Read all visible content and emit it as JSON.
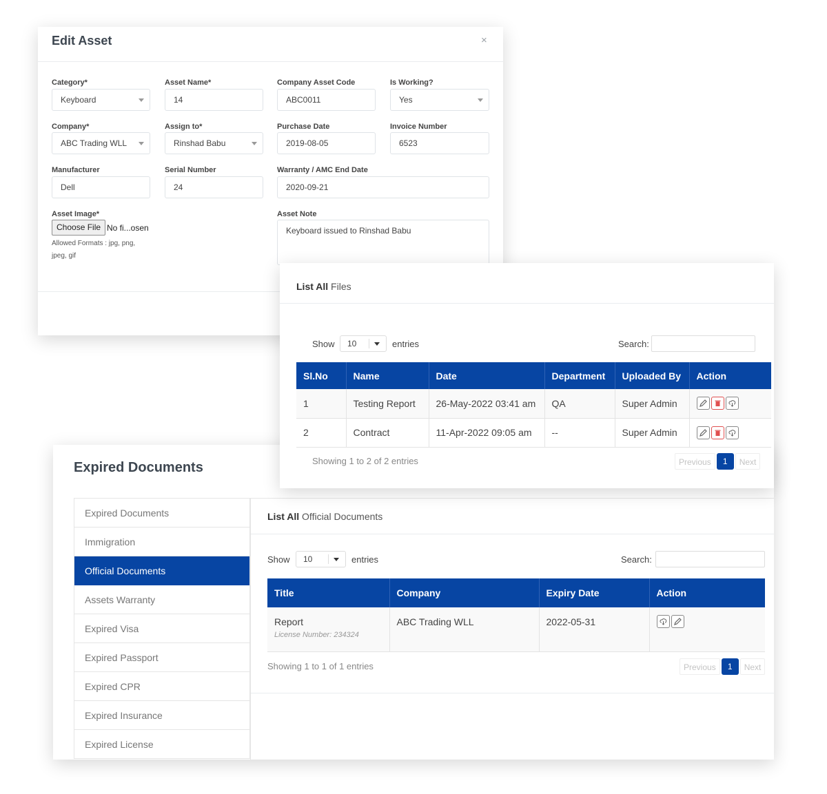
{
  "edit_asset": {
    "title": "Edit Asset",
    "close": "×",
    "fields": {
      "category": {
        "label": "Category*",
        "value": "Keyboard"
      },
      "asset_name": {
        "label": "Asset Name*",
        "value": "14"
      },
      "company_asset_code": {
        "label": "Company Asset Code",
        "value": "ABC0011"
      },
      "is_working": {
        "label": "Is Working?",
        "value": "Yes"
      },
      "company": {
        "label": "Company*",
        "value": "ABC Trading WLL"
      },
      "assign_to": {
        "label": "Assign to*",
        "value": "Rinshad Babu"
      },
      "purchase_date": {
        "label": "Purchase Date",
        "value": "2019-08-05"
      },
      "invoice_number": {
        "label": "Invoice Number",
        "value": "6523"
      },
      "manufacturer": {
        "label": "Manufacturer",
        "value": "Dell"
      },
      "serial_number": {
        "label": "Serial Number",
        "value": "24"
      },
      "warranty_end": {
        "label": "Warranty / AMC End Date",
        "value": "2020-09-21"
      },
      "asset_image": {
        "label": "Asset Image*",
        "button": "Choose File",
        "status": "No fi...osen",
        "hint": "Allowed Formats : jpg, png, jpeg, gif"
      },
      "asset_note": {
        "label": "Asset Note",
        "value": "Keyboard issued to Rinshad Babu"
      }
    }
  },
  "files_panel": {
    "title_bold": "List All",
    "title_rest": "Files",
    "show_label": "Show",
    "entries_value": "10",
    "entries_label": "entries",
    "search_label": "Search:",
    "columns": [
      "Sl.No",
      "Name",
      "Date",
      "Department",
      "Uploaded By",
      "Action"
    ],
    "rows": [
      {
        "sl": "1",
        "name": "Testing Report",
        "date": "26-May-2022 03:41 am",
        "department": "QA",
        "uploaded_by": "Super Admin"
      },
      {
        "sl": "2",
        "name": "Contract",
        "date": "11-Apr-2022 09:05 am",
        "department": "--",
        "uploaded_by": "Super Admin"
      }
    ],
    "info": "Showing 1 to 2 of 2 entries",
    "pagination": {
      "previous": "Previous",
      "current": "1",
      "next": "Next"
    }
  },
  "expired_panel": {
    "title": "Expired Documents",
    "sidebar": [
      {
        "label": "Expired Documents",
        "active": false
      },
      {
        "label": "Immigration",
        "active": false
      },
      {
        "label": "Official Documents",
        "active": true
      },
      {
        "label": "Assets Warranty",
        "active": false
      },
      {
        "label": "Expired Visa",
        "active": false
      },
      {
        "label": "Expired Passport",
        "active": false
      },
      {
        "label": "Expired CPR",
        "active": false
      },
      {
        "label": "Expired Insurance",
        "active": false
      },
      {
        "label": "Expired License",
        "active": false
      }
    ],
    "list_title_bold": "List All",
    "list_title_rest": "Official Documents",
    "show_label": "Show",
    "entries_value": "10",
    "entries_label": "entries",
    "search_label": "Search:",
    "columns": [
      "Title",
      "Company",
      "Expiry Date",
      "Action"
    ],
    "rows": [
      {
        "title": "Report",
        "license": "License Number: 234324",
        "company": "ABC Trading WLL",
        "expiry": "2022-05-31"
      }
    ],
    "info": "Showing 1 to 1 of 1 entries",
    "pagination": {
      "previous": "Previous",
      "current": "1",
      "next": "Next"
    }
  },
  "colors": {
    "primary": "#0745a3",
    "danger": "#e05050"
  }
}
